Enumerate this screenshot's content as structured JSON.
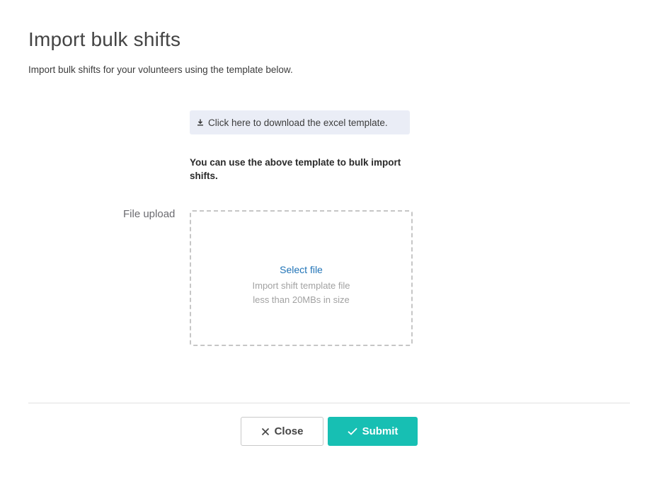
{
  "modal": {
    "title": "Import bulk shifts",
    "subtitle": "Import bulk shifts for your volunteers using the template below."
  },
  "download": {
    "label": "Click here to download the excel template.",
    "icon": "download-icon"
  },
  "hint": "You can use the above template to bulk import shifts.",
  "upload": {
    "label": "File upload",
    "select_label": "Select file",
    "description_line1": "Import shift template file",
    "description_line2": "less than 20MBs in size"
  },
  "footer": {
    "close_label": "Close",
    "close_icon": "close-icon",
    "submit_label": "Submit",
    "submit_icon": "check-icon"
  },
  "colors": {
    "accent": "#17bfb3",
    "link": "#1f73b7",
    "download_bg": "#eaedf6"
  }
}
